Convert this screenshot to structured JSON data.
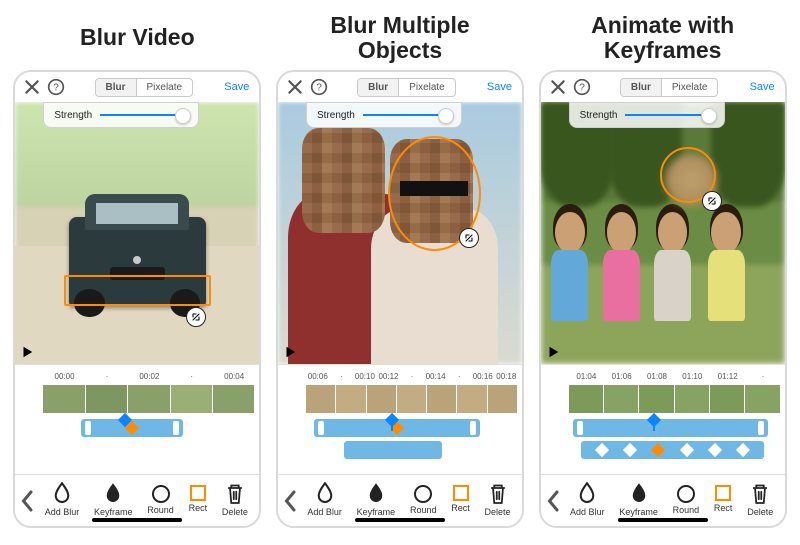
{
  "panes": [
    {
      "headline": "Blur Video"
    },
    {
      "headline": "Blur Multiple\nObjects"
    },
    {
      "headline": "Animate with\nKeyframes"
    }
  ],
  "topbar": {
    "close_label": "Close",
    "help_label": "Help",
    "save_label": "Save",
    "segments": {
      "blur": "Blur",
      "pixelate": "Pixelate"
    }
  },
  "strength": {
    "label": "Strength"
  },
  "timeline": {
    "p1": [
      "00:00",
      "·",
      "00:02",
      "·",
      "00:04"
    ],
    "p2": [
      "00:06",
      "·",
      "00:10",
      "00:12",
      "·",
      "00:14",
      "·",
      "00:16",
      "00:18"
    ],
    "p3": [
      "01:04",
      "01:06",
      "01:08",
      "01:10",
      "01:12",
      "·"
    ]
  },
  "toolbar": {
    "back_label": "Back",
    "add_blur": "Add Blur",
    "keyframe": "Keyframe",
    "round": "Round",
    "rect": "Rect",
    "delete": "Delete"
  }
}
